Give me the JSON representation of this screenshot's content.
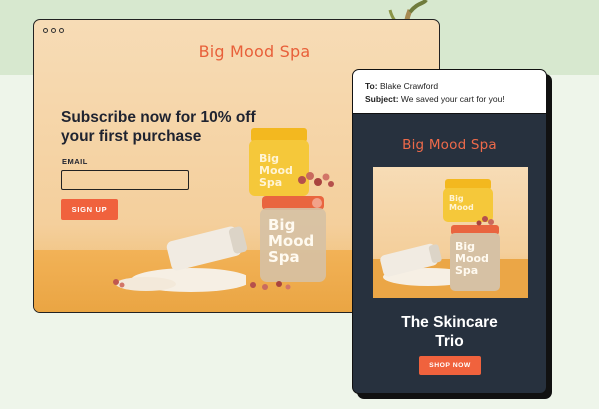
{
  "landing": {
    "brand": "Big Mood Spa",
    "headline": "Subscribe now for 10% off your first purchase",
    "email_label": "EMAIL",
    "email_value": "",
    "signup_label": "SIGN UP",
    "jar_label": "Big Mood Spa"
  },
  "email": {
    "to_label": "To:",
    "to_value": "Blake Crawford",
    "subject_label": "Subject:",
    "subject_value": "We saved your cart for you!",
    "brand": "Big Mood Spa",
    "title": "The Skincare Trio",
    "shop_label": "SHOP NOW"
  },
  "colors": {
    "accent": "#f0623d",
    "dark_panel": "#27313e",
    "bg_green": "#d7e8cf"
  }
}
